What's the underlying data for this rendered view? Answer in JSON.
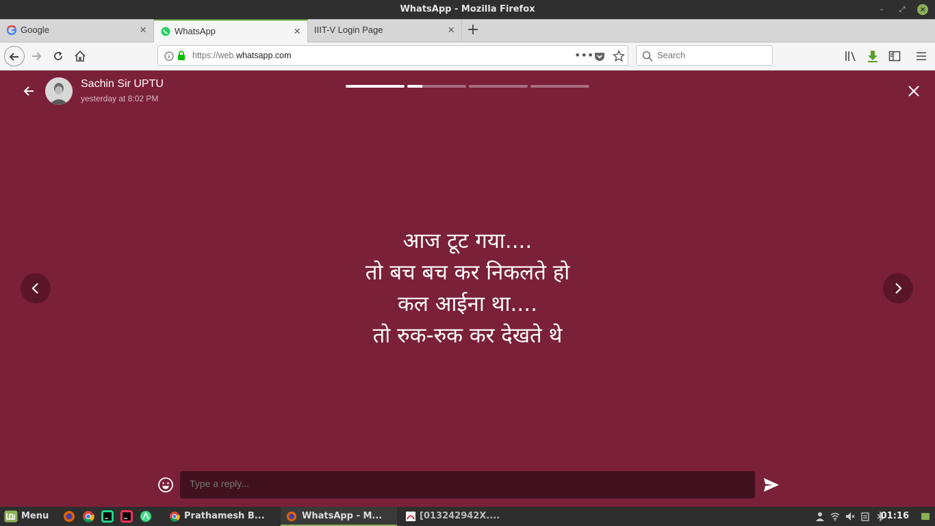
{
  "window": {
    "title": "WhatsApp - Mozilla Firefox"
  },
  "tabs": [
    {
      "label": "Google",
      "icon": "google-icon"
    },
    {
      "label": "WhatsApp",
      "icon": "whatsapp-icon",
      "active": true
    },
    {
      "label": "IIIT-V Login Page",
      "icon": ""
    }
  ],
  "navbar": {
    "url_prefix": "https://web.",
    "url_domain": "whatsapp.com",
    "search_placeholder": "Search"
  },
  "status": {
    "contact_name": "Sachin Sir UPTU",
    "timestamp": "yesterday at 8:02 PM",
    "background_color": "#7b2039",
    "segments_total": 4,
    "current_segment": 2,
    "segment_progress": [
      1.0,
      0.25,
      0.0,
      0.0
    ],
    "lines": [
      "आज टूट गया....",
      "तो बच बच कर निकलते हो",
      "कल आईना था....",
      "तो रुक-रुक कर देखते थे"
    ],
    "reply_placeholder": "Type a reply..."
  },
  "taskbar": {
    "menu_label": "Menu",
    "windows": [
      {
        "label": "Prathamesh B...",
        "icon": "chrome-icon"
      },
      {
        "label": "WhatsApp - M...",
        "icon": "firefox-icon",
        "active": true
      },
      {
        "label": "[013242942X....",
        "icon": "pdf-icon"
      }
    ],
    "clock": "01:16"
  }
}
